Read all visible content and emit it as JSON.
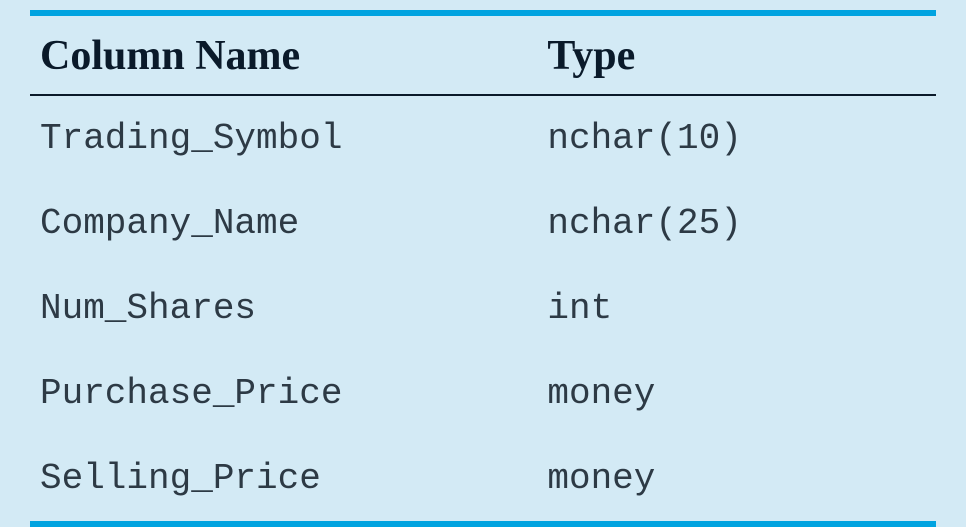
{
  "chart_data": {
    "type": "table",
    "headers": [
      "Column Name",
      "Type"
    ],
    "rows": [
      {
        "name": "Trading_Symbol",
        "type": "nchar(10)"
      },
      {
        "name": "Company_Name",
        "type": "nchar(25)"
      },
      {
        "name": "Num_Shares",
        "type": "int"
      },
      {
        "name": "Purchase_Price",
        "type": "money"
      },
      {
        "name": "Selling_Price",
        "type": "money"
      }
    ]
  }
}
